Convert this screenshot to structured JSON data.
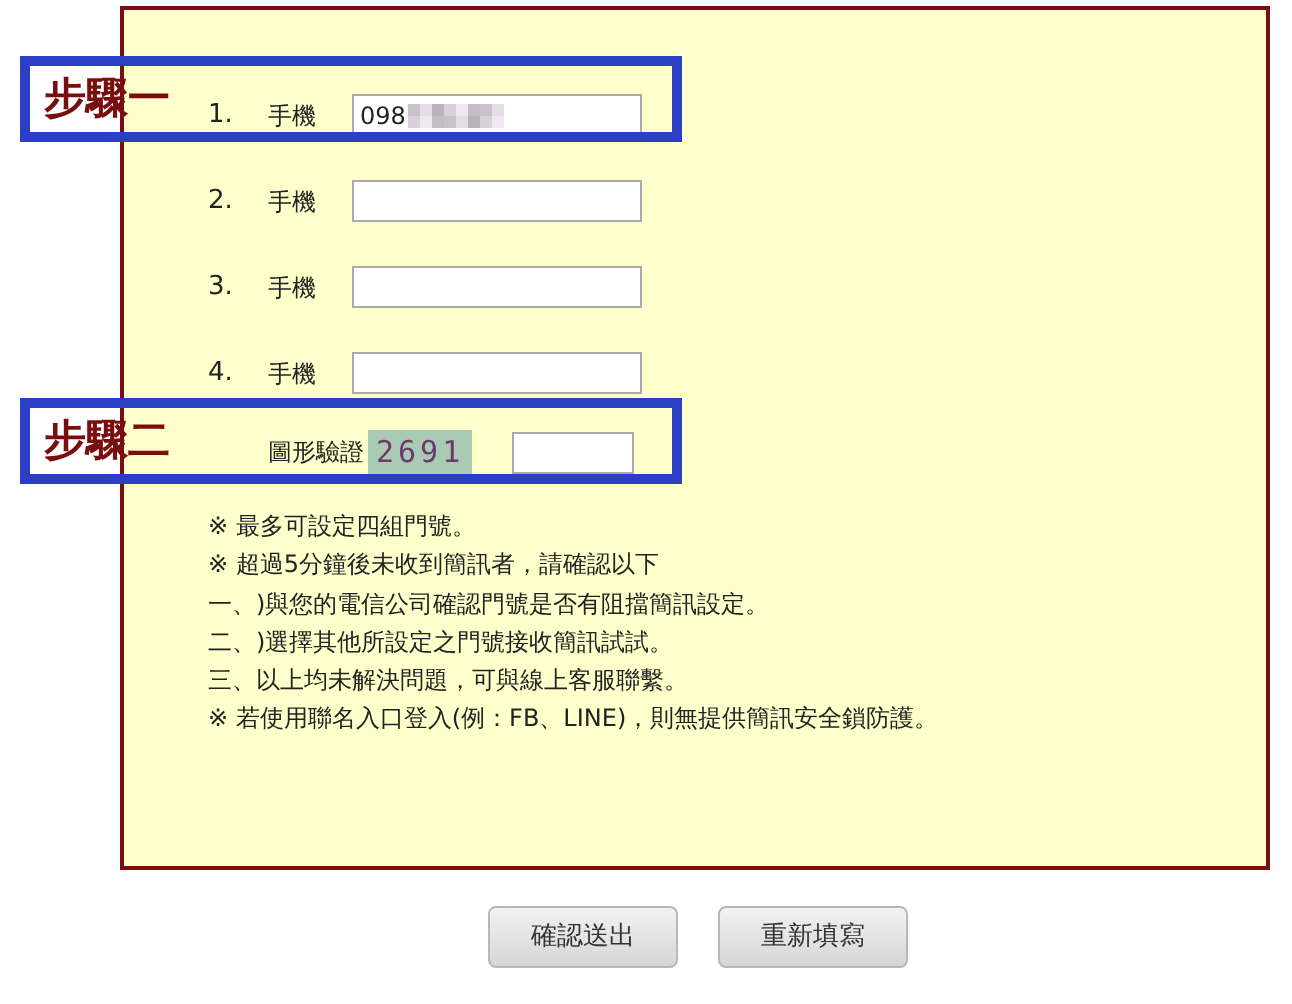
{
  "steps": [
    {
      "label": "步驟一"
    },
    {
      "label": "步驟二"
    }
  ],
  "phones": [
    {
      "number": "1.",
      "label": "手機",
      "value": "098",
      "redacted": true
    },
    {
      "number": "2.",
      "label": "手機",
      "redacted": false
    },
    {
      "number": "3.",
      "label": "手機",
      "redacted": false
    },
    {
      "number": "4.",
      "label": "手機",
      "redacted": false
    }
  ],
  "captcha": {
    "label": "圖形驗證",
    "code": "2691"
  },
  "notes": [
    "※ 最多可設定四組門號。",
    "※ 超過5分鐘後未收到簡訊者，請確認以下",
    "一、)與您的電信公司確認門號是否有阻擋簡訊設定。",
    "二、)選擇其他所設定之門號接收簡訊試試。",
    "三、以上均未解決問題，可與線上客服聯繫。",
    "※ 若使用聯名入口登入(例：FB、LINE)，則無提供簡訊安全鎖防護。"
  ],
  "buttons": [
    "確認送出",
    "重新填寫"
  ]
}
